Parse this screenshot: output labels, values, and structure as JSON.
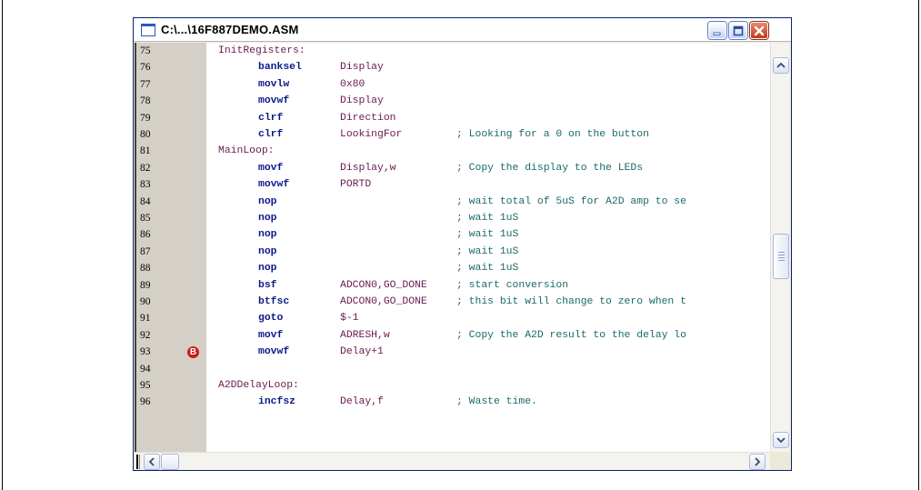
{
  "window": {
    "title": "C:\\...\\16F887DEMO.ASM",
    "buttons": [
      "minimize-icon",
      "maximize-icon",
      "close-icon"
    ]
  },
  "editor": {
    "breakpoint_marker": "B",
    "lines": [
      {
        "num": "75",
        "label": "InitRegisters:",
        "instr": "",
        "operand": "",
        "comment": ""
      },
      {
        "num": "76",
        "label": "",
        "instr": "banksel",
        "operand": "Display",
        "comment": ""
      },
      {
        "num": "77",
        "label": "",
        "instr": "movlw",
        "operand": "0x80",
        "comment": ""
      },
      {
        "num": "78",
        "label": "",
        "instr": "movwf",
        "operand": "Display",
        "comment": ""
      },
      {
        "num": "79",
        "label": "",
        "instr": "clrf",
        "operand": "Direction",
        "comment": ""
      },
      {
        "num": "80",
        "label": "",
        "instr": "clrf",
        "operand": "LookingFor",
        "comment": "; Looking for a 0 on the button"
      },
      {
        "num": "81",
        "label": "MainLoop:",
        "instr": "",
        "operand": "",
        "comment": ""
      },
      {
        "num": "82",
        "label": "",
        "instr": "movf",
        "operand": "Display,w",
        "comment": "; Copy the display to the LEDs"
      },
      {
        "num": "83",
        "label": "",
        "instr": "movwf",
        "operand": "PORTD",
        "comment": ""
      },
      {
        "num": "84",
        "label": "",
        "instr": "nop",
        "operand": "",
        "comment": "; wait total of 5uS for A2D amp to se"
      },
      {
        "num": "85",
        "label": "",
        "instr": "nop",
        "operand": "",
        "comment": "; wait 1uS"
      },
      {
        "num": "86",
        "label": "",
        "instr": "nop",
        "operand": "",
        "comment": "; wait 1uS"
      },
      {
        "num": "87",
        "label": "",
        "instr": "nop",
        "operand": "",
        "comment": "; wait 1uS"
      },
      {
        "num": "88",
        "label": "",
        "instr": "nop",
        "operand": "",
        "comment": "; wait 1uS"
      },
      {
        "num": "89",
        "label": "",
        "instr": "bsf",
        "operand": "ADCON0,GO_DONE",
        "comment": "; start conversion"
      },
      {
        "num": "90",
        "label": "",
        "instr": "btfsc",
        "operand": "ADCON0,GO_DONE",
        "comment": "; this bit will change to zero when t"
      },
      {
        "num": "91",
        "label": "",
        "instr": "goto",
        "operand": "$-1",
        "comment": ""
      },
      {
        "num": "92",
        "label": "",
        "instr": "movf",
        "operand": "ADRESH,w",
        "comment": "; Copy the A2D result to the delay lo"
      },
      {
        "num": "93",
        "label": "",
        "instr": "movwf",
        "operand": "Delay+1",
        "comment": ""
      },
      {
        "num": "94",
        "label": "",
        "instr": "",
        "operand": "",
        "comment": ""
      },
      {
        "num": "95",
        "label": "A2DDelayLoop:",
        "instr": "",
        "operand": "",
        "comment": ""
      },
      {
        "num": "96",
        "label": "",
        "instr": "incfsz",
        "operand": "Delay,f",
        "comment": "; Waste time."
      }
    ]
  },
  "colors": {
    "gutter": "#d4d0c8",
    "label": "#6a1a50",
    "instruction": "#0a1a8c",
    "comment": "#1a6a6a",
    "breakpoint": "#d01818"
  }
}
